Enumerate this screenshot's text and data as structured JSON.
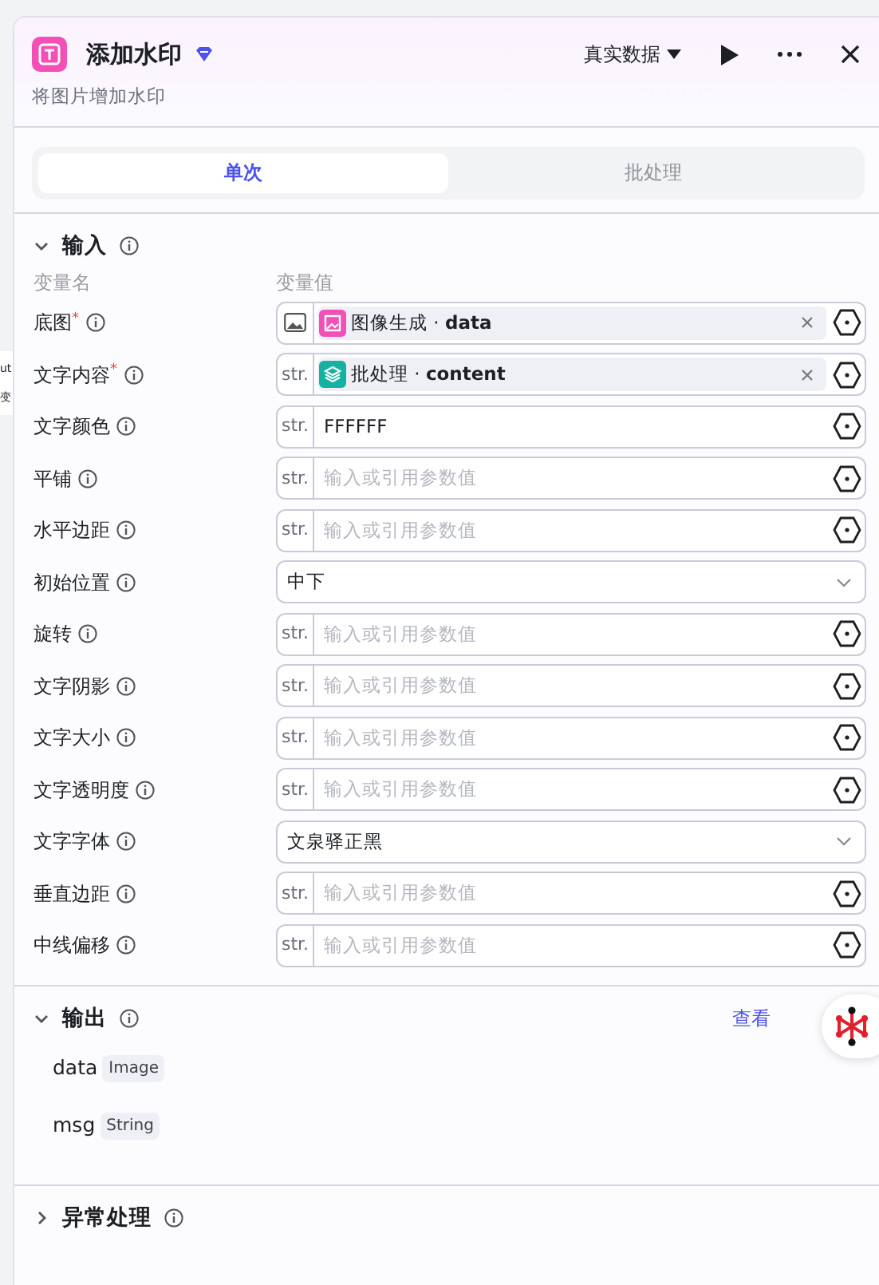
{
  "canvas_fragments": [
    "ut",
    "变"
  ],
  "header": {
    "title": "添加水印",
    "subtitle": "将图片增加水印",
    "data_mode": "真实数据"
  },
  "tabs": [
    {
      "label": "单次",
      "selected": true
    },
    {
      "label": "批处理",
      "selected": false
    }
  ],
  "input_section": {
    "title": "输入",
    "expanded": true,
    "column_1": "变量名",
    "column_2": "变量值",
    "rows": [
      {
        "label": "底图$^{*}$",
        "kind": "ref",
        "prefix": {
          "kind": "image"
        },
        "ref": {
          "kind": "image",
          "text": "图像生成 · **data**",
          "color": "#f24fb7"
        }
      },
      {
        "label": "文字内容$^{*}$",
        "kind": "ref",
        "prefix": {
          "kind": "text",
          "text": "str."
        },
        "ref": {
          "kind": "layers",
          "text": "批处理 · **content**",
          "color": "#15b2a2"
        }
      },
      {
        "label": "文字颜色",
        "kind": "text",
        "prefix": {
          "kind": "text",
          "text": "str."
        },
        "value": "FFFFFF"
      },
      {
        "label": "平铺",
        "kind": "text",
        "prefix": {
          "kind": "text",
          "text": "str."
        },
        "placeholder": "输入或引用参数值"
      },
      {
        "label": "水平边距",
        "kind": "text",
        "prefix": {
          "kind": "text",
          "text": "str."
        },
        "placeholder": "输入或引用参数值"
      },
      {
        "label": "初始位置",
        "kind": "select",
        "value": "中下"
      },
      {
        "label": "旋转",
        "kind": "text",
        "prefix": {
          "kind": "text",
          "text": "str."
        },
        "placeholder": "输入或引用参数值"
      },
      {
        "label": "文字阴影",
        "kind": "text",
        "prefix": {
          "kind": "text",
          "text": "str."
        },
        "placeholder": "输入或引用参数值"
      },
      {
        "label": "文字大小",
        "kind": "text",
        "prefix": {
          "kind": "text",
          "text": "str."
        },
        "placeholder": "输入或引用参数值"
      },
      {
        "label": "文字透明度",
        "kind": "text",
        "prefix": {
          "kind": "text",
          "text": "str."
        },
        "placeholder": "输入或引用参数值"
      },
      {
        "label": "文字字体",
        "kind": "select",
        "value": "文泉驿正黑"
      },
      {
        "label": "垂直边距",
        "kind": "text",
        "prefix": {
          "kind": "text",
          "text": "str."
        },
        "placeholder": "输入或引用参数值"
      },
      {
        "label": "中线偏移",
        "kind": "text",
        "prefix": {
          "kind": "text",
          "text": "str."
        },
        "placeholder": "输入或引用参数值"
      }
    ]
  },
  "output_section": {
    "title": "输出",
    "expanded": true,
    "link": "查看",
    "outputs": [
      {
        "name": "data",
        "type": "Image"
      },
      {
        "name": "msg",
        "type": "String"
      }
    ]
  },
  "error_section": {
    "title": "异常处理",
    "expanded": false
  }
}
